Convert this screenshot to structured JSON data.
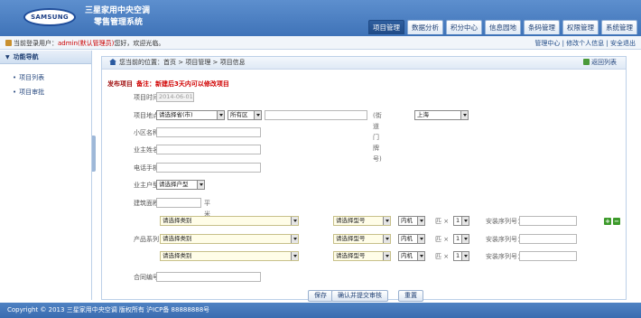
{
  "header": {
    "logo_text": "SAMSUNG",
    "title_line1": "三星家用中央空调",
    "title_line2": "零售管理系统",
    "tabs": [
      {
        "label": "项目管理",
        "active": true
      },
      {
        "label": "数据分析",
        "active": false
      },
      {
        "label": "积分中心",
        "active": false
      },
      {
        "label": "信息园地",
        "active": false
      },
      {
        "label": "条码管理",
        "active": false
      },
      {
        "label": "权限管理",
        "active": false
      },
      {
        "label": "系统管理",
        "active": false
      }
    ]
  },
  "userbar": {
    "prefix": "当前登录用户：",
    "user": "admin(默认管理员)",
    "suffix": "您好，欢迎光临。",
    "links": [
      "管理中心",
      "修改个人信息",
      "安全退出"
    ]
  },
  "sidebar": {
    "heading": "功能导航",
    "items": [
      "项目列表",
      "项目审批"
    ]
  },
  "breadcrumb": {
    "prefix": "您当前的位置：",
    "path": "首页 > 项目管理 > 项目信息",
    "back": "返回列表"
  },
  "form": {
    "section_title": "发布项目",
    "note": "备注：新建后3天内可以修改项目",
    "labels": {
      "time": "项目时间：",
      "location": "项目地点：",
      "community": "小区名称：",
      "owner_name": "业主姓名：",
      "phone": "电话手机：",
      "owner_type": "业主户型：",
      "area": "建筑面积：",
      "product_series": "产品系列：",
      "contract_no": "合同编号："
    },
    "time_value": "2014-06-01",
    "province_select": "请选择省(市)",
    "district_select": "所有区",
    "street_hint": "(街道门牌号)",
    "city_select": "上海",
    "owner_type_select": "请选择户型",
    "area_unit": "平米",
    "product_rows": [
      {
        "category": "请选择类别",
        "model": "请选择型号",
        "unit": "内机",
        "qty": "1",
        "serial_label": "安装序列号："
      },
      {
        "category": "请选择类别",
        "model": "请选择型号",
        "unit": "内机",
        "qty": "1",
        "serial_label": "安装序列号："
      },
      {
        "category": "请选择类别",
        "model": "请选择型号",
        "unit": "内机",
        "qty": "1",
        "serial_label": "安装序列号："
      }
    ],
    "qty_prefix": "匹 ×",
    "add_glyph": "+",
    "remove_glyph": "−"
  },
  "buttons": {
    "save": "保存",
    "confirm_submit": "确认并提交审核",
    "reset": "重置"
  },
  "footer": {
    "text": "Copyright © 2013 三星家用中央空调 版权所有 沪ICP备 88888888号"
  }
}
